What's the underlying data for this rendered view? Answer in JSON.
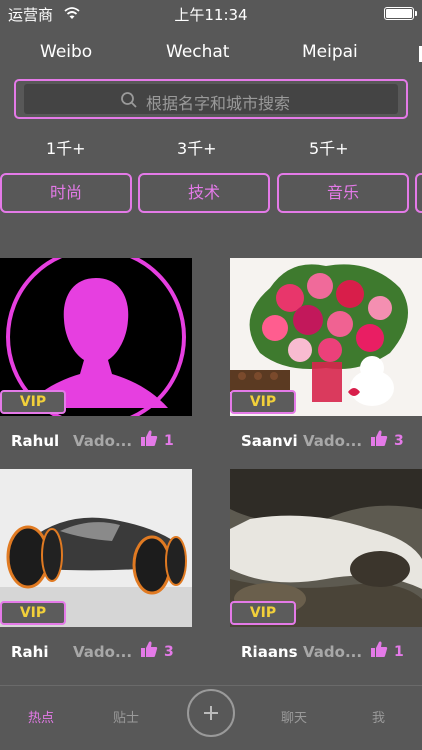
{
  "status_bar": {
    "carrier": "运营商",
    "time": "上午11:34",
    "battery_level": 1.0
  },
  "platform_tabs": [
    "Weibo",
    "Wechat",
    "Meipai"
  ],
  "search": {
    "placeholder": "根据名字和城市搜索"
  },
  "follower_filters": [
    "1千+",
    "3千+",
    "5千+"
  ],
  "categories": [
    "时尚",
    "技术",
    "音乐"
  ],
  "profiles": [
    {
      "name": "Rahul",
      "location": "Vado...",
      "likes": "1",
      "badge": "VIP",
      "image": "default-avatar-placeholder"
    },
    {
      "name": "Saanvi",
      "location": "Vado...",
      "likes": "3",
      "badge": "VIP",
      "image": "flower-bouquet-with-teddy-bear"
    },
    {
      "name": "Rahi",
      "location": "Vado...",
      "likes": "3",
      "badge": "VIP",
      "image": "concept-sports-car"
    },
    {
      "name": "Riaans",
      "location": "Vado...",
      "likes": "1",
      "badge": "VIP",
      "image": "waterfall-rocks"
    }
  ],
  "tab_bar": {
    "items": [
      "热点",
      "贴士",
      "聊天",
      "我"
    ],
    "active": "热点",
    "center_icon": "plus-icon"
  },
  "colors": {
    "accent": "#e47ae8",
    "background": "#585858",
    "vip_text": "#f2d03a"
  }
}
